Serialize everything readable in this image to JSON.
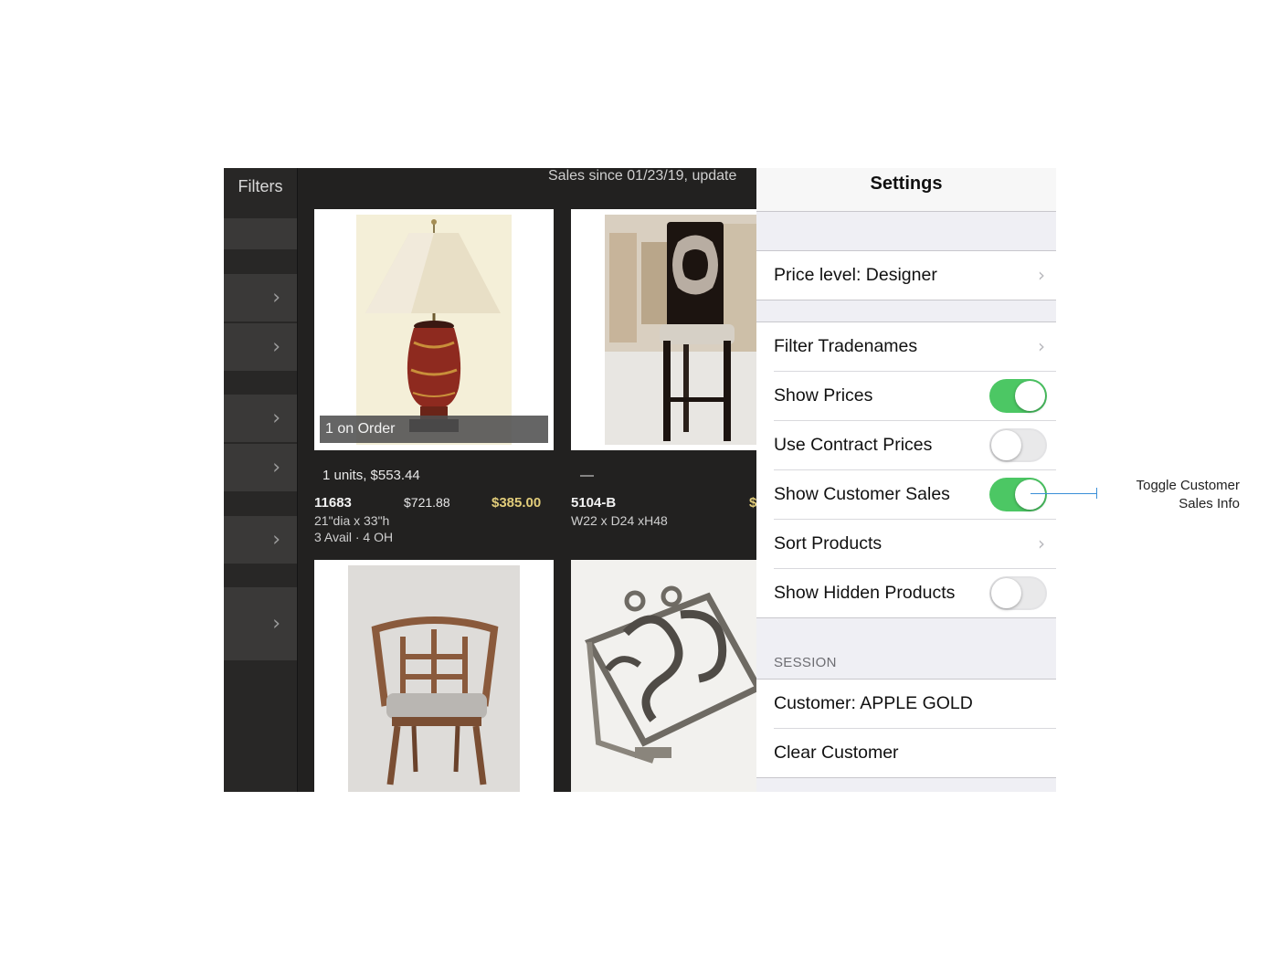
{
  "sidebar": {
    "title": "Filters"
  },
  "grid": {
    "banner": "Sales since 01/23/19, update",
    "products": [
      {
        "badge": "1 on Order",
        "sales": "1 units, $553.44",
        "sku": "11683",
        "list_price": "$721.88",
        "sale_price": "$385.00",
        "dims": "21\"dia x 33\"h",
        "availability": "3 Avail · 4 OH",
        "image": "table-lamp"
      },
      {
        "sales": "—",
        "sku": "5104-B",
        "price_fragment": "$",
        "dims": "W22 x D24 xH48",
        "image": "bar-stool"
      },
      {
        "image": "fretwork-chair"
      },
      {
        "image": "scroll-book-stand"
      }
    ]
  },
  "settings": {
    "title": "Settings",
    "price_level": "Price level: Designer",
    "filter_tradenames": "Filter Tradenames",
    "show_prices": "Show Prices",
    "use_contract_prices": "Use Contract Prices",
    "show_customer_sales": "Show Customer Sales",
    "sort_products": "Sort Products",
    "show_hidden_products": "Show Hidden Products",
    "session_header": "SESSION",
    "customer": "Customer: APPLE GOLD",
    "clear_customer": "Clear Customer",
    "toggles": {
      "show_prices": true,
      "use_contract_prices": false,
      "show_customer_sales": true,
      "show_hidden_products": false
    }
  },
  "annotation": {
    "line1": "Toggle Customer",
    "line2": "Sales Info"
  },
  "colors": {
    "toggle_on": "#4cc764",
    "sale_price": "#e1cc7a",
    "callout": "#3a8fd8"
  }
}
